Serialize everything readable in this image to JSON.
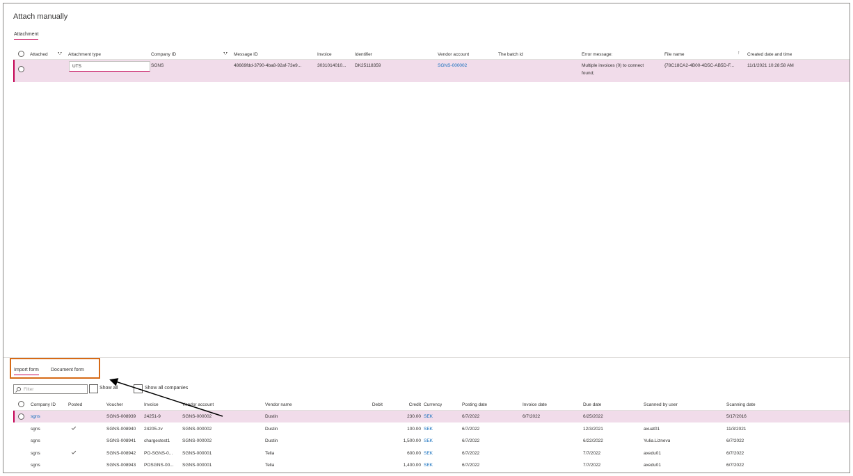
{
  "page": {
    "title": "Attach manually",
    "tab_attachment": "Attachment"
  },
  "top_grid": {
    "headers": {
      "attached": "Attached",
      "attachment_type": "Attachment type",
      "company_id": "Company ID",
      "message_id": "Message ID",
      "invoice": "Invoice",
      "identifier": "Identifier",
      "vendor_account": "Vendor account",
      "batch_id": "The batch id",
      "error_message": "Error message:",
      "file_name": "File name",
      "created": "Created date and time"
    },
    "row": {
      "attachment_type": "UTS",
      "company_id": "SGNS",
      "message_id": "48669fdd-3790-4ba8-92af-73e9...",
      "invoice": "3031014010...",
      "identifier": "DK25118359",
      "vendor_account": "SGNS-000002",
      "batch_id": "",
      "error_line1": "Multiple invoices (0) to connect",
      "error_line2": "found;",
      "file_name": "{78C18CA2-4B00-4D5C-AB5D-F...",
      "created": "11/1/2021 10:28:58 AM"
    }
  },
  "bottom_tabs": {
    "import_form": "Import form",
    "document_form": "Document form"
  },
  "bottom_toolbar": {
    "filter_placeholder": "Filter",
    "show_all": "Show all",
    "show_all_companies": "Show all companies"
  },
  "bottom_grid": {
    "headers": {
      "company_id": "Company ID",
      "posted": "Posted",
      "voucher": "Voucher",
      "invoice": "Invoice",
      "vendor_account": "Vendor account",
      "vendor_name": "Vendor name",
      "debit": "Debit",
      "credit": "Credit",
      "currency": "Currency",
      "posting_date": "Posting date",
      "invoice_date": "Invoice date",
      "due_date": "Due date",
      "scanned_by": "Scanned by user",
      "scanning_date": "Scanning date"
    },
    "rows": [
      {
        "company_id": "sgns",
        "posted": false,
        "voucher": "SGNS-008939",
        "invoice": "24251-9",
        "vendor_account": "SGNS-000002",
        "vendor_name": "Dustin",
        "debit": "",
        "credit": "230.00",
        "currency": "SEK",
        "posting_date": "6/7/2022",
        "invoice_date": "6/7/2022",
        "due_date": "6/25/2022",
        "scanned_by": "",
        "scanning_date": "5/17/2016"
      },
      {
        "company_id": "sgns",
        "posted": true,
        "voucher": "SGNS-008940",
        "invoice": "24205-zv",
        "vendor_account": "SGNS-000002",
        "vendor_name": "Dustin",
        "debit": "",
        "credit": "100.00",
        "currency": "SEK",
        "posting_date": "6/7/2022",
        "invoice_date": "",
        "due_date": "12/3/2021",
        "scanned_by": "axuat01",
        "scanning_date": "11/3/2021"
      },
      {
        "company_id": "sgns",
        "posted": false,
        "voucher": "SGNS-008941",
        "invoice": "chargestest1",
        "vendor_account": "SGNS-000002",
        "vendor_name": "Dustin",
        "debit": "",
        "credit": "1,500.00",
        "currency": "SEK",
        "posting_date": "6/7/2022",
        "invoice_date": "",
        "due_date": "6/22/2022",
        "scanned_by": "Yulia.Lizneva",
        "scanning_date": "6/7/2022"
      },
      {
        "company_id": "sgns",
        "posted": true,
        "voucher": "SGNS-008942",
        "invoice": "PO-SGNS-0...",
        "vendor_account": "SGNS-000001",
        "vendor_name": "Telia",
        "debit": "",
        "credit": "600.00",
        "currency": "SEK",
        "posting_date": "6/7/2022",
        "invoice_date": "",
        "due_date": "7/7/2022",
        "scanned_by": "axedu01",
        "scanning_date": "6/7/2022"
      },
      {
        "company_id": "sgns",
        "posted": false,
        "voucher": "SGNS-008943",
        "invoice": "POSGNS-00...",
        "vendor_account": "SGNS-000001",
        "vendor_name": "Telia",
        "debit": "",
        "credit": "1,400.00",
        "currency": "SEK",
        "posting_date": "6/7/2022",
        "invoice_date": "",
        "due_date": "7/7/2022",
        "scanned_by": "axedu01",
        "scanning_date": "6/7/2022"
      }
    ]
  },
  "colors": {
    "accent": "#c30052",
    "selected_row": "#f1dcea",
    "link": "#0f6cbd",
    "highlight_box": "#d66a16"
  }
}
